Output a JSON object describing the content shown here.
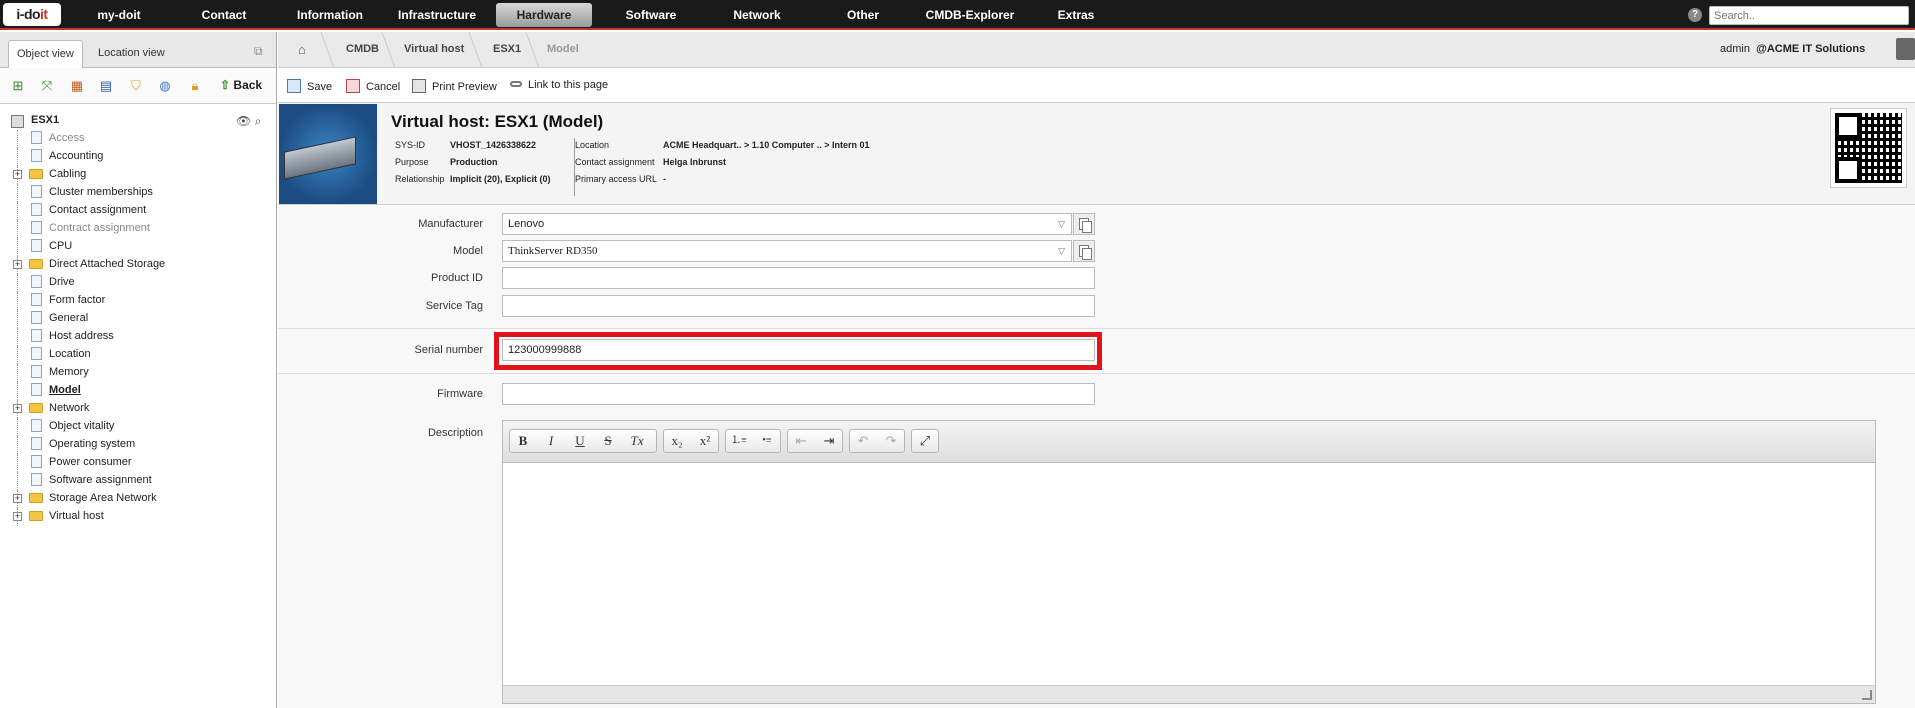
{
  "topnav": {
    "logo": [
      "i-do",
      "it"
    ],
    "items": [
      {
        "label": "my-doit"
      },
      {
        "label": "Contact"
      },
      {
        "label": "Information"
      },
      {
        "label": "Infrastructure"
      },
      {
        "label": "Hardware"
      },
      {
        "label": "Software"
      },
      {
        "label": "Network"
      },
      {
        "label": "Other"
      },
      {
        "label": "CMDB-Explorer"
      },
      {
        "label": "Extras"
      }
    ],
    "active_item": "Hardware",
    "help_icon": "?",
    "search_placeholder": "Search.."
  },
  "leftpanel": {
    "tabs": [
      "Object view",
      "Location view"
    ],
    "back_label": "Back",
    "root": "ESX1",
    "tree": [
      {
        "label": "Access",
        "type": "doc",
        "dim": true
      },
      {
        "label": "Accounting",
        "type": "doc"
      },
      {
        "label": "Cabling",
        "type": "folder"
      },
      {
        "label": "Cluster memberships",
        "type": "doc"
      },
      {
        "label": "Contact assignment",
        "type": "doc"
      },
      {
        "label": "Contract assignment",
        "type": "doc",
        "dim": true
      },
      {
        "label": "CPU",
        "type": "doc"
      },
      {
        "label": "Direct Attached Storage",
        "type": "folder"
      },
      {
        "label": "Drive",
        "type": "doc"
      },
      {
        "label": "Form factor",
        "type": "doc"
      },
      {
        "label": "General",
        "type": "doc"
      },
      {
        "label": "Host address",
        "type": "doc"
      },
      {
        "label": "Location",
        "type": "doc"
      },
      {
        "label": "Memory",
        "type": "doc"
      },
      {
        "label": "Model",
        "type": "doc",
        "selected": true
      },
      {
        "label": "Network",
        "type": "folder"
      },
      {
        "label": "Object vitality",
        "type": "doc"
      },
      {
        "label": "Operating system",
        "type": "doc"
      },
      {
        "label": "Power consumer",
        "type": "doc"
      },
      {
        "label": "Software assignment",
        "type": "doc"
      },
      {
        "label": "Storage Area Network",
        "type": "folder"
      },
      {
        "label": "Virtual host",
        "type": "folder"
      }
    ]
  },
  "breadcrumb": [
    "CMDB",
    "Virtual host",
    "ESX1",
    "Model"
  ],
  "user": {
    "name": "admin",
    "tenant": "@ACME IT Solutions"
  },
  "actions": {
    "save": "Save",
    "cancel": "Cancel",
    "print": "Print Preview",
    "link": "Link to this page"
  },
  "object": {
    "title": "Virtual host: ESX1 (Model)",
    "sysid_label": "SYS-ID",
    "sysid": "VHOST_1426338622",
    "purpose_label": "Purpose",
    "purpose": "Production",
    "relationship_label": "Relationship",
    "relationship": "Implicit (20), Explicit (0)",
    "location_label": "Location",
    "location": "ACME Headquart.. > 1.10 Computer .. > Intern 01",
    "contact_label": "Contact assignment",
    "contact": "Helga Inbrunst",
    "url_label": "Primary access URL",
    "url": "-"
  },
  "form": {
    "manufacturer_label": "Manufacturer",
    "manufacturer": "Lenovo",
    "model_label": "Model",
    "model": "ThinkServer RD350",
    "product_id_label": "Product ID",
    "product_id": "",
    "service_tag_label": "Service Tag",
    "service_tag": "",
    "serial_label": "Serial number",
    "serial": "123000999888",
    "firmware_label": "Firmware",
    "firmware": "",
    "description_label": "Description",
    "editor_buttons": [
      "B",
      "I",
      "U",
      "S",
      "Tx",
      "x₂",
      "x²",
      "⒈≡",
      "•≡",
      "⇤",
      "⇥",
      "↶",
      "↷",
      "⤢"
    ]
  }
}
